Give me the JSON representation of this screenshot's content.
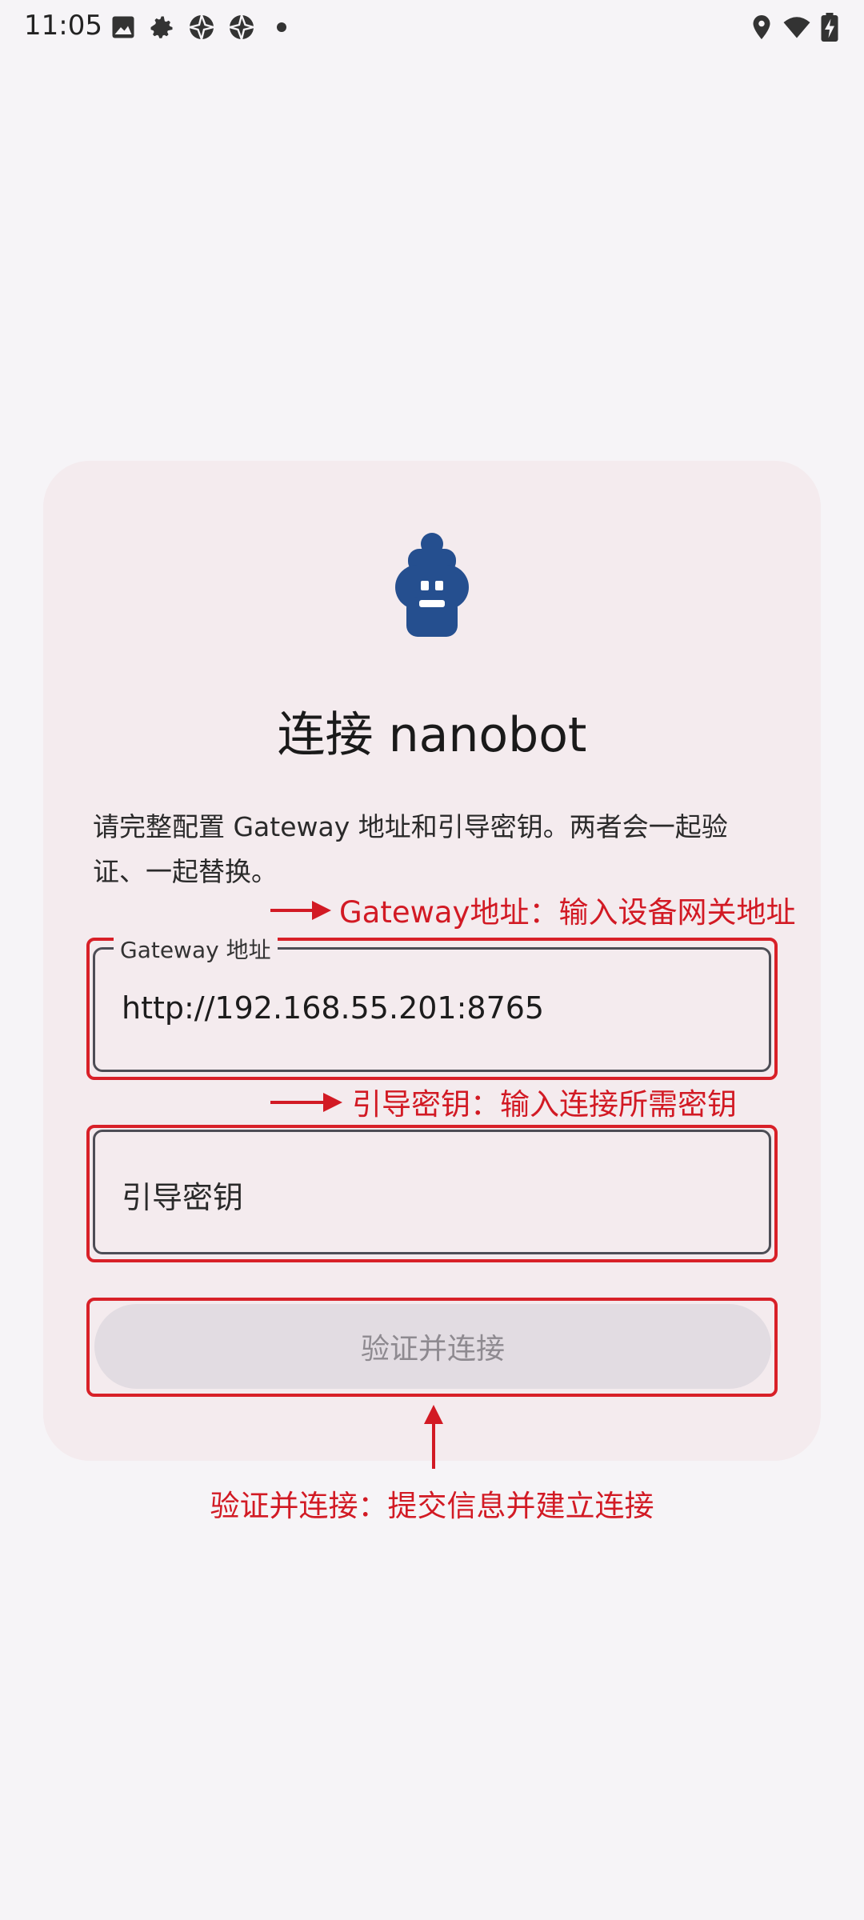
{
  "status_bar": {
    "time": "11:05",
    "left_icons": [
      "image-icon",
      "settings-icon",
      "aperture-icon",
      "aperture-icon",
      "dot-icon"
    ],
    "right_icons": [
      "location-icon",
      "wifi-icon",
      "battery-charging-icon"
    ]
  },
  "card": {
    "logo_icon": "robot-icon",
    "title": "连接 nanobot",
    "description": "请完整配置 Gateway 地址和引导密钥。两者会一起验证、一起替换。",
    "gateway_field": {
      "label": "Gateway 地址",
      "value": "http://192.168.55.201:8765"
    },
    "key_field": {
      "placeholder": "引导密钥"
    },
    "submit_label": "验证并连接"
  },
  "annotations": {
    "gateway": "Gateway地址：输入设备网关地址",
    "key": "引导密钥：输入连接所需密钥",
    "submit": "验证并连接：提交信息并建立连接",
    "color": "#d21a24"
  },
  "colors": {
    "background": "#f6f4f7",
    "card": "#f4ebee",
    "logo": "#254f8f",
    "button_disabled": "#e2dce2"
  }
}
